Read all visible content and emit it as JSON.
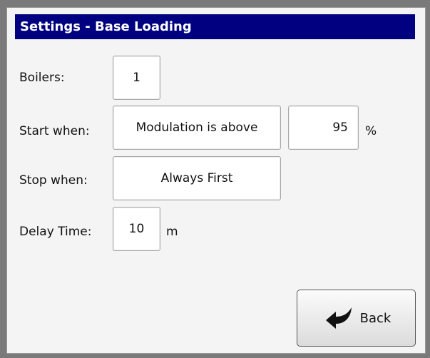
{
  "title": "Settings - Base Loading",
  "boilers": {
    "label": "Boilers:",
    "value": "1"
  },
  "start_when": {
    "label": "Start when:",
    "condition": "Modulation is above",
    "value": "95",
    "unit": "%"
  },
  "stop_when": {
    "label": "Stop when:",
    "value": "Always First"
  },
  "delay_time": {
    "label": "Delay Time:",
    "value": "10",
    "unit": "m"
  },
  "back_button": {
    "label": "Back",
    "icon": "back-arrow-icon"
  },
  "colors": {
    "title_bg": "#000080",
    "panel_bg": "#f4f4f4",
    "field_bg": "#ffffff"
  }
}
